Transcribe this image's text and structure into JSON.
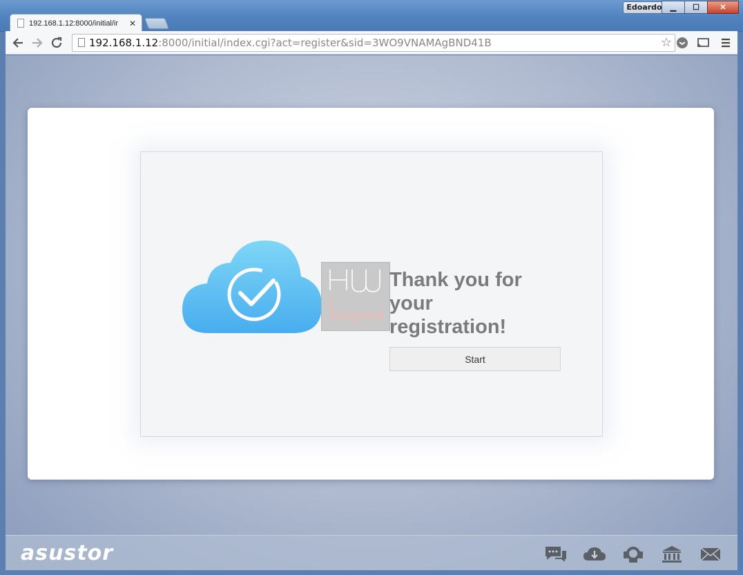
{
  "window": {
    "user": "Edoardo",
    "controls": {
      "minimize": "▁",
      "maximize": "☐",
      "close": "✕"
    }
  },
  "tab": {
    "title": "192.168.1.12:8000/initial/ir",
    "close": "✕"
  },
  "omnibox": {
    "host": "192.168.1.12",
    "rest": ":8000/initial/index.cgi?act=register&sid=3WO9VNAMAgBND41B"
  },
  "page": {
    "thanks_text": "Thank you for your registration!",
    "start_label": "Start",
    "watermark": "HW Legend"
  },
  "footer": {
    "logo": "asustor",
    "icons": [
      "chat-icon",
      "cloud-download-icon",
      "support-icon",
      "bank-icon",
      "mail-icon"
    ]
  },
  "colors": {
    "cloud_top": "#7fd3f5",
    "cloud_bottom": "#4aaff0",
    "heading": "#7b7b7b"
  }
}
